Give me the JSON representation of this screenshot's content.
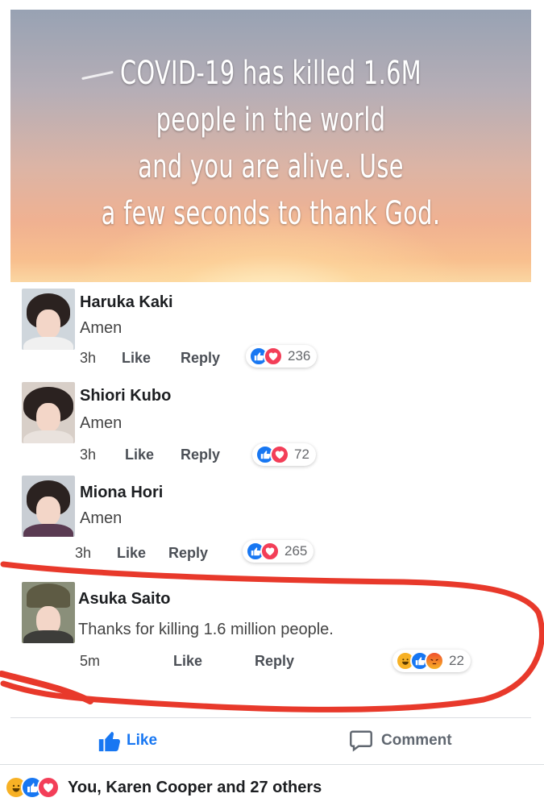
{
  "post": {
    "image_text_lines": [
      "COVID-19 has killed 1.6M",
      "people in the world",
      "and you are alive. Use",
      "a few seconds to thank God."
    ]
  },
  "comments": [
    {
      "author": "Haruka Kaki",
      "text": "Amen",
      "time": "3h",
      "like_label": "Like",
      "reply_label": "Reply",
      "reactions": [
        "like",
        "love"
      ],
      "reaction_count": "236"
    },
    {
      "author": "Shiori Kubo",
      "text": "Amen",
      "time": "3h",
      "like_label": "Like",
      "reply_label": "Reply",
      "reactions": [
        "like",
        "love"
      ],
      "reaction_count": "72"
    },
    {
      "author": "Miona Hori",
      "text": "Amen",
      "time": "3h",
      "like_label": "Like",
      "reply_label": "Reply",
      "reactions": [
        "like",
        "love"
      ],
      "reaction_count": "265"
    },
    {
      "author": "Asuka Saito",
      "text": "Thanks for killing 1.6 million people.",
      "time": "5m",
      "like_label": "Like",
      "reply_label": "Reply",
      "reactions": [
        "haha",
        "like",
        "angry"
      ],
      "reaction_count": "22"
    }
  ],
  "action_bar": {
    "like_label": "Like",
    "comment_label": "Comment",
    "like_icon": "thumbs-up-icon",
    "comment_icon": "speech-bubble-icon"
  },
  "summary": {
    "reactions": [
      "haha",
      "like",
      "love"
    ],
    "text": "You, Karen Cooper and 27 others"
  },
  "colors": {
    "facebook_blue": "#1877f2",
    "love_red": "#f33e58",
    "haha_yellow": "#f7b125",
    "annotation_red": "#e8392b"
  }
}
